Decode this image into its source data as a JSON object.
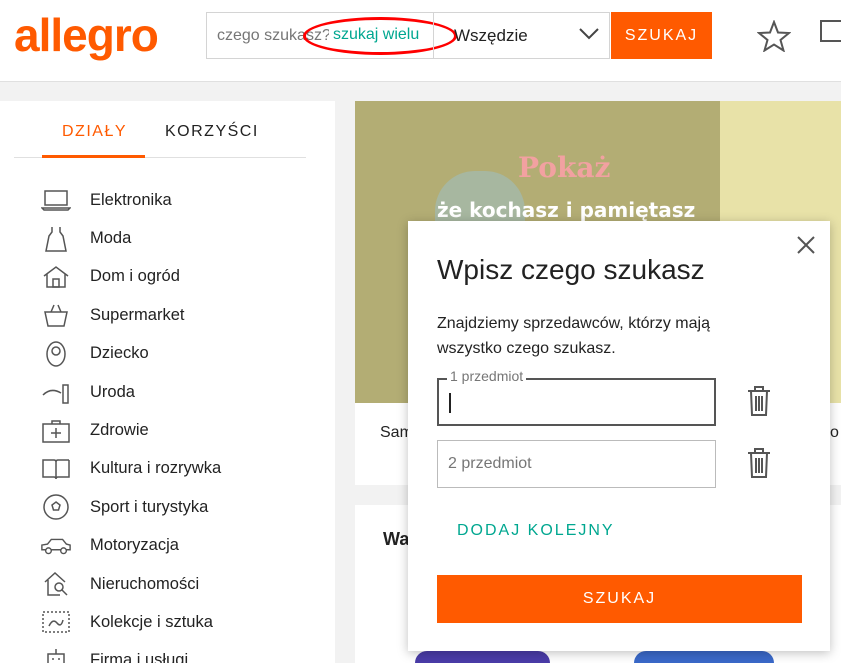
{
  "header": {
    "logo": "allegro",
    "search_placeholder": "czego szukasz?",
    "search_many_link": "szukaj wielu",
    "category_value": "Wszędzie",
    "search_button": "SZUKAJ"
  },
  "sidebar": {
    "tabs": [
      "DZIAŁY",
      "KORZYŚCI"
    ],
    "categories": [
      {
        "label": "Elektronika",
        "icon": "laptop-icon"
      },
      {
        "label": "Moda",
        "icon": "dress-icon"
      },
      {
        "label": "Dom i ogród",
        "icon": "house-icon"
      },
      {
        "label": "Supermarket",
        "icon": "basket-icon"
      },
      {
        "label": "Dziecko",
        "icon": "baby-icon"
      },
      {
        "label": "Uroda",
        "icon": "lipstick-icon"
      },
      {
        "label": "Zdrowie",
        "icon": "first-aid-icon"
      },
      {
        "label": "Kultura i rozrywka",
        "icon": "book-icon"
      },
      {
        "label": "Sport i turystyka",
        "icon": "ball-icon"
      },
      {
        "label": "Motoryzacja",
        "icon": "car-icon"
      },
      {
        "label": "Nieruchomości",
        "icon": "house-search-icon"
      },
      {
        "label": "Kolekcje i sztuka",
        "icon": "stamp-icon"
      },
      {
        "label": "Firma i usługi",
        "icon": "building-icon"
      }
    ]
  },
  "banner": {
    "headline": "Pokaż",
    "subline": "że kochasz i pamiętasz",
    "caption_left": "Sam",
    "caption_right": "o"
  },
  "lower_card": {
    "title": "Wa"
  },
  "modal": {
    "title": "Wpisz czego szukasz",
    "description": "Znajdziemy sprzedawców, którzy mają wszystko czego szukasz.",
    "field1_label": "1 przedmiot",
    "field1_value": "",
    "field2_placeholder": "2 przedmiot",
    "field2_value": "",
    "add_more": "DODAJ KOLEJNY",
    "submit": "SZUKAJ"
  },
  "colors": {
    "brand": "#ff5a00",
    "accent": "#00a790",
    "annotation": "#ff0000"
  }
}
